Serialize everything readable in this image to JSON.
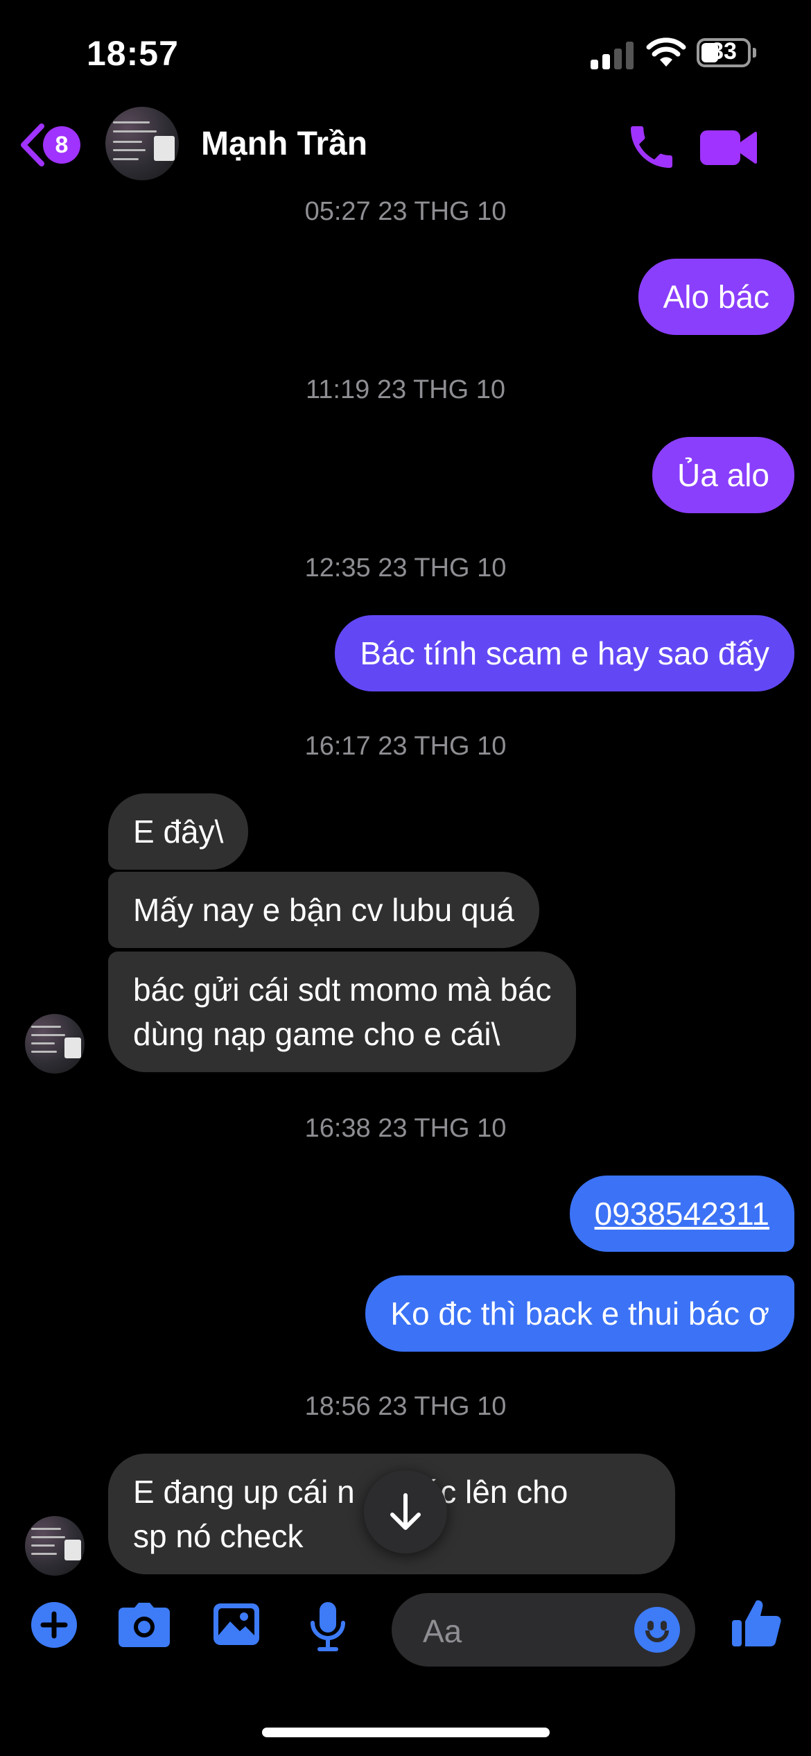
{
  "status_bar": {
    "time": "18:57",
    "battery": "33"
  },
  "header": {
    "back_badge": "8",
    "contact_name": "Mạnh Trần"
  },
  "messages": [
    {
      "kind": "timestamp",
      "text": "05:27 23 THG 10"
    },
    {
      "kind": "out",
      "text": "Alo bác"
    },
    {
      "kind": "timestamp",
      "text": "11:19 23 THG 10"
    },
    {
      "kind": "out",
      "text": "Ủa alo"
    },
    {
      "kind": "timestamp",
      "text": "12:35 23 THG 10"
    },
    {
      "kind": "out",
      "text": "Bác tính scam e hay sao đấy"
    },
    {
      "kind": "timestamp",
      "text": "16:17 23 THG 10"
    },
    {
      "kind": "in",
      "text": "E đây\\"
    },
    {
      "kind": "in",
      "text": "Mấy nay e bận cv lubu quá"
    },
    {
      "kind": "in",
      "line1": "bác gửi cái sdt momo mà bác",
      "line2": "dùng nạp game cho e cái\\"
    },
    {
      "kind": "timestamp",
      "text": "16:38 23 THG 10"
    },
    {
      "kind": "out",
      "text": "0938542311"
    },
    {
      "kind": "out",
      "text": "Ko đc thì back e thui bác ơ"
    },
    {
      "kind": "timestamp",
      "text": "18:56 23 THG 10"
    },
    {
      "kind": "in",
      "line1": "E đang up cái n",
      "line1_end": "o bác lên cho",
      "line2": "sp nó check"
    }
  ],
  "composer": {
    "placeholder": "Aa"
  },
  "colors": {
    "accent": "#8a3ffc",
    "indigo": "#6248f5",
    "blue": "#3b72f6",
    "incoming": "#303030",
    "icon_blue": "#3d7bf7",
    "header_purple": "#a033ff"
  },
  "icons": [
    "back-chevron-icon",
    "phone-icon",
    "video-camera-icon",
    "plus-icon",
    "camera-icon",
    "image-icon",
    "microphone-icon",
    "emoji-icon",
    "thumbs-up-icon",
    "arrow-down-icon"
  ]
}
